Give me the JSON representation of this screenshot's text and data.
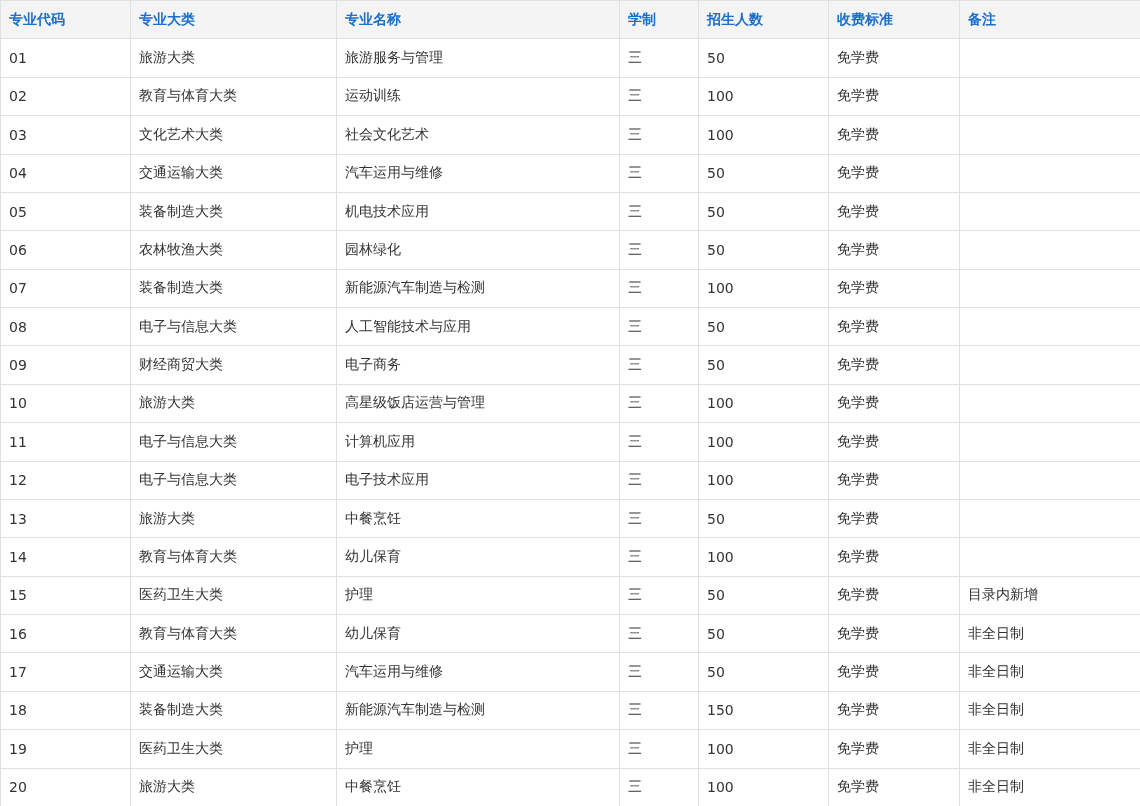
{
  "table": {
    "columns": [
      "专业代码",
      "专业大类",
      "专业名称",
      "学制",
      "招生人数",
      "收费标准",
      "备注"
    ],
    "rows": [
      {
        "code": "01",
        "category": "旅游大类",
        "major": "旅游服务与管理",
        "years": "三",
        "enrollment": "50",
        "fee": "免学费"
      },
      {
        "code": "02",
        "category": "教育与体育大类",
        "major": "运动训练",
        "years": "三",
        "enrollment": "100",
        "fee": "免学费"
      },
      {
        "code": "03",
        "category": "文化艺术大类",
        "major": "社会文化艺术",
        "years": "三",
        "enrollment": "100",
        "fee": "免学费"
      },
      {
        "code": "04",
        "category": "交通运输大类",
        "major": "汽车运用与维修",
        "years": "三",
        "enrollment": "50",
        "fee": "免学费"
      },
      {
        "code": "05",
        "category": "装备制造大类",
        "major": "机电技术应用",
        "years": "三",
        "enrollment": "50",
        "fee": "免学费"
      },
      {
        "code": "06",
        "category": "农林牧渔大类",
        "major": "园林绿化",
        "years": "三",
        "enrollment": "50",
        "fee": "免学费"
      },
      {
        "code": "07",
        "category": "装备制造大类",
        "major": "新能源汽车制造与检测",
        "years": "三",
        "enrollment": "100",
        "fee": "免学费"
      },
      {
        "code": "08",
        "category": "电子与信息大类",
        "major": "人工智能技术与应用",
        "years": "三",
        "enrollment": "50",
        "fee": "免学费"
      },
      {
        "code": "09",
        "category": "财经商贸大类",
        "major": "电子商务",
        "years": "三",
        "enrollment": "50",
        "fee": "免学费"
      },
      {
        "code": "10",
        "category": "旅游大类",
        "major": "高星级饭店运营与管理",
        "years": "三",
        "enrollment": "100",
        "fee": "免学费"
      },
      {
        "code": "11",
        "category": "电子与信息大类",
        "major": "计算机应用",
        "years": "三",
        "enrollment": "100",
        "fee": "免学费"
      },
      {
        "code": "12",
        "category": "电子与信息大类",
        "major": "电子技术应用",
        "years": "三",
        "enrollment": "100",
        "fee": "免学费"
      },
      {
        "code": "13",
        "category": "旅游大类",
        "major": "中餐烹饪",
        "years": "三",
        "enrollment": "50",
        "fee": "免学费"
      },
      {
        "code": "14",
        "category": "教育与体育大类",
        "major": "幼儿保育",
        "years": "三",
        "enrollment": "100",
        "fee": "免学费"
      },
      {
        "code": "15",
        "category": "医药卫生大类",
        "major": "护理",
        "years": "三",
        "enrollment": "50",
        "fee": "免学费",
        "remark": "目录内新增"
      },
      {
        "code": "16",
        "category": "教育与体育大类",
        "major": "幼儿保育",
        "years": "三",
        "enrollment": "50",
        "fee": "免学费",
        "remark": "非全日制"
      },
      {
        "code": "17",
        "category": "交通运输大类",
        "major": "汽车运用与维修",
        "years": "三",
        "enrollment": "50",
        "fee": "免学费",
        "remark": "非全日制"
      },
      {
        "code": "18",
        "category": "装备制造大类",
        "major": "新能源汽车制造与检测",
        "years": "三",
        "enrollment": "150",
        "fee": "免学费",
        "remark": "非全日制"
      },
      {
        "code": "19",
        "category": "医药卫生大类",
        "major": "护理",
        "years": "三",
        "enrollment": "100",
        "fee": "免学费",
        "remark": "非全日制"
      },
      {
        "code": "20",
        "category": "旅游大类",
        "major": "中餐烹饪",
        "years": "三",
        "enrollment": "100",
        "fee": "免学费",
        "remark": "非全日制"
      }
    ]
  }
}
